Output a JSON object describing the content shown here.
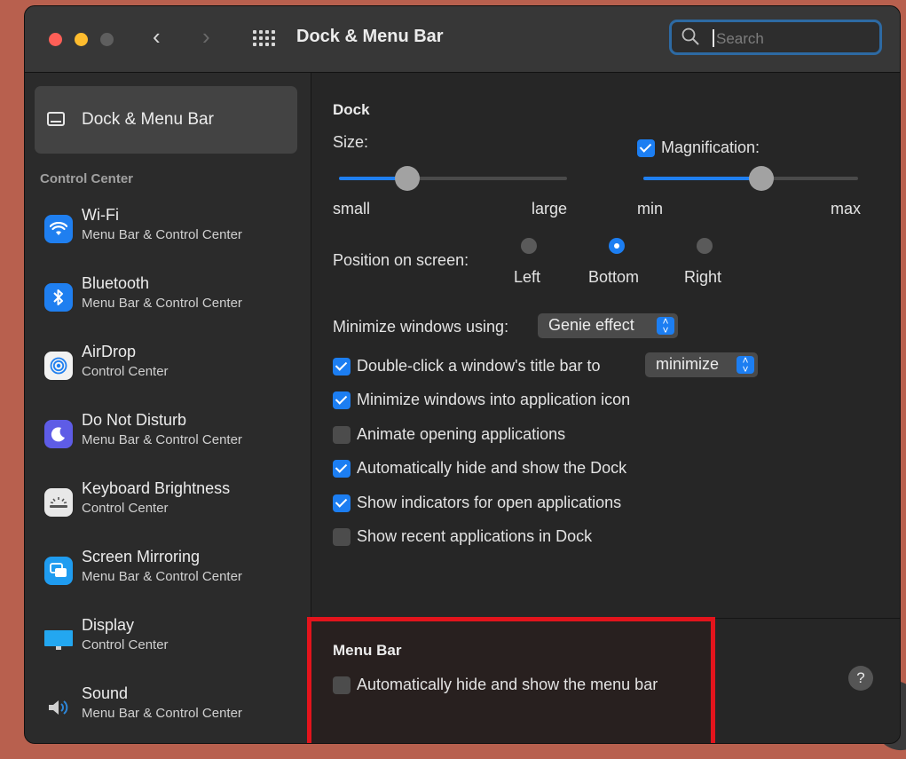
{
  "window": {
    "title": "Dock & Menu Bar"
  },
  "toolbar": {
    "search_placeholder": "Search"
  },
  "sidebar": {
    "selected_label": "Dock & Menu Bar",
    "section_title": "Control Center",
    "items": [
      {
        "title": "Wi-Fi",
        "subtitle": "Menu Bar & Control Center",
        "icon": "wifi-icon",
        "color": "#1f7ff0"
      },
      {
        "title": "Bluetooth",
        "subtitle": "Menu Bar & Control Center",
        "icon": "bluetooth-icon",
        "color": "#1f7ff0"
      },
      {
        "title": "AirDrop",
        "subtitle": "Control Center",
        "icon": "airdrop-icon",
        "color": "#ffffff"
      },
      {
        "title": "Do Not Disturb",
        "subtitle": "Menu Bar & Control Center",
        "icon": "moon-icon",
        "color": "#5e5ce6"
      },
      {
        "title": "Keyboard Brightness",
        "subtitle": "Control Center",
        "icon": "keyboard-brightness-icon",
        "color": "#e6e6e6"
      },
      {
        "title": "Screen Mirroring",
        "subtitle": "Menu Bar & Control Center",
        "icon": "screen-mirroring-icon",
        "color": "#1f9cf0"
      },
      {
        "title": "Display",
        "subtitle": "Control Center",
        "icon": "display-icon",
        "color": "#1fb0f0"
      },
      {
        "title": "Sound",
        "subtitle": "Menu Bar & Control Center",
        "icon": "speaker-icon",
        "color": "#d0d0d0"
      }
    ]
  },
  "dock": {
    "heading": "Dock",
    "size_label": "Size:",
    "size_level": 0.3,
    "size_min_label": "small",
    "size_max_label": "large",
    "magnification_label": "Magnification:",
    "magnification_checked": true,
    "magnification_level": 0.55,
    "mag_min_label": "min",
    "mag_max_label": "max",
    "position_label": "Position on screen:",
    "positions": [
      "Left",
      "Bottom",
      "Right"
    ],
    "position_selected": "Bottom",
    "minimize_label": "Minimize windows using:",
    "minimize_value": "Genie effect",
    "double_click_label": "Double-click a window's title bar to",
    "double_click_value": "minimize",
    "options": [
      {
        "label": "Minimize windows into application icon",
        "checked": true
      },
      {
        "label": "Animate opening applications",
        "checked": false
      },
      {
        "label": "Automatically hide and show the Dock",
        "checked": true
      },
      {
        "label": "Show indicators for open applications",
        "checked": true
      },
      {
        "label": "Show recent applications in Dock",
        "checked": false
      }
    ]
  },
  "menubar": {
    "heading": "Menu Bar",
    "auto_hide_label": "Automatically hide and show the menu bar",
    "auto_hide_checked": false
  },
  "help": {
    "label": "?"
  },
  "colors": {
    "accent": "#1c7ef2",
    "highlight_border": "#e3141c"
  }
}
